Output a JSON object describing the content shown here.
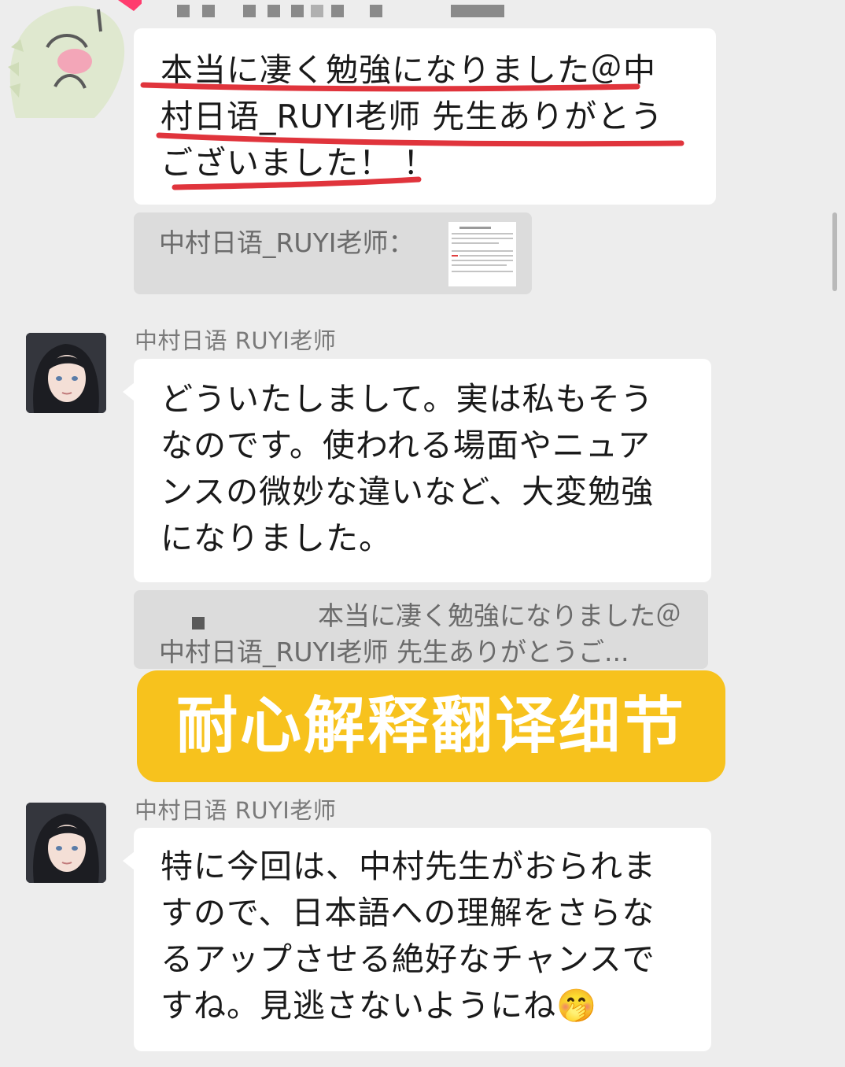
{
  "header": {
    "blurred_name": "■ ■ ■ ■ ■ ■ ■"
  },
  "messages": [
    {
      "lines": [
        "本当に凄く勉強になりました＠中",
        "村日语_RUYI老师 先生ありがとう",
        "ございました！ ！"
      ]
    },
    {
      "quote_sender": "中村日语_RUYI老师：",
      "quote_icon": "document-thumbnail-icon"
    },
    {
      "sender": "中村日语 RUYI老师",
      "lines": [
        "どういたしまして。実は私もそう",
        "なのです。使われる場面やニュア",
        "ンスの微妙な違いなど、大変勉強",
        "になりました。"
      ]
    },
    {
      "quote_lines": [
        "本当に凄く勉強になりました＠",
        "中村日语_RUYI老师 先生ありがとうご..."
      ]
    },
    {
      "sender": "中村日语 RUYI老师",
      "lines": [
        "特に今回は、中村先生がおられま",
        "すので、日本語への理解をさらな",
        "るアップさせる絶好なチャンスで",
        "すね。見逃さないようにね"
      ],
      "emoji": "🤭"
    }
  ],
  "overlay": {
    "caption": "耐心解释翻译细节",
    "caption_color": "#f7c21d"
  },
  "colors": {
    "background": "#ededed",
    "bubble": "#ffffff",
    "quote": "#dcdcdc",
    "underline": "#e0343c"
  }
}
